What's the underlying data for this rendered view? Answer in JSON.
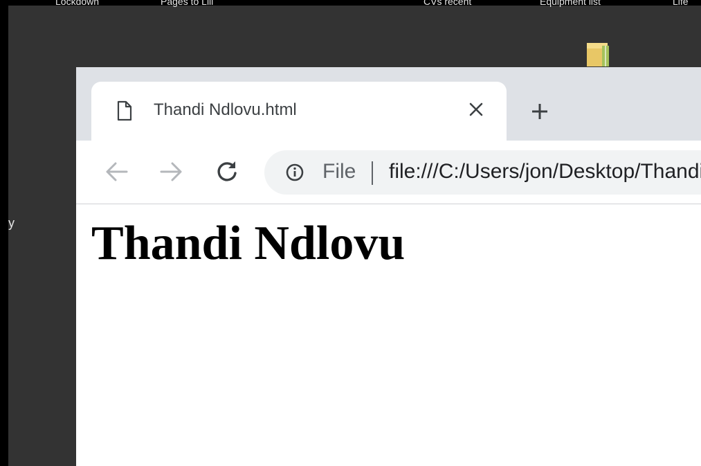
{
  "desktop": {
    "background": "#333333",
    "labels": [
      "Lockdown",
      "Pages to Lili",
      "CVs recent",
      "Equipment list",
      "Life"
    ],
    "stray_glyph": "y",
    "folder_icon": "folder-icon"
  },
  "browser": {
    "tab": {
      "favicon": "document-icon",
      "title": "Thandi Ndlovu.html",
      "close_icon": "close-icon"
    },
    "new_tab_icon": "plus-icon",
    "toolbar": {
      "back_icon": "back-arrow-icon",
      "forward_icon": "forward-arrow-icon",
      "reload_icon": "reload-icon",
      "info_icon": "info-icon",
      "scheme_chip": "File",
      "url": "file:///C:/Users/jon/Desktop/Thandi Ndlovu.html"
    },
    "colors": {
      "tabstrip": "#dee1e6",
      "omnibox": "#f1f3f4",
      "icon": "#5f6368"
    }
  },
  "page": {
    "heading": "Thandi Ndlovu"
  }
}
